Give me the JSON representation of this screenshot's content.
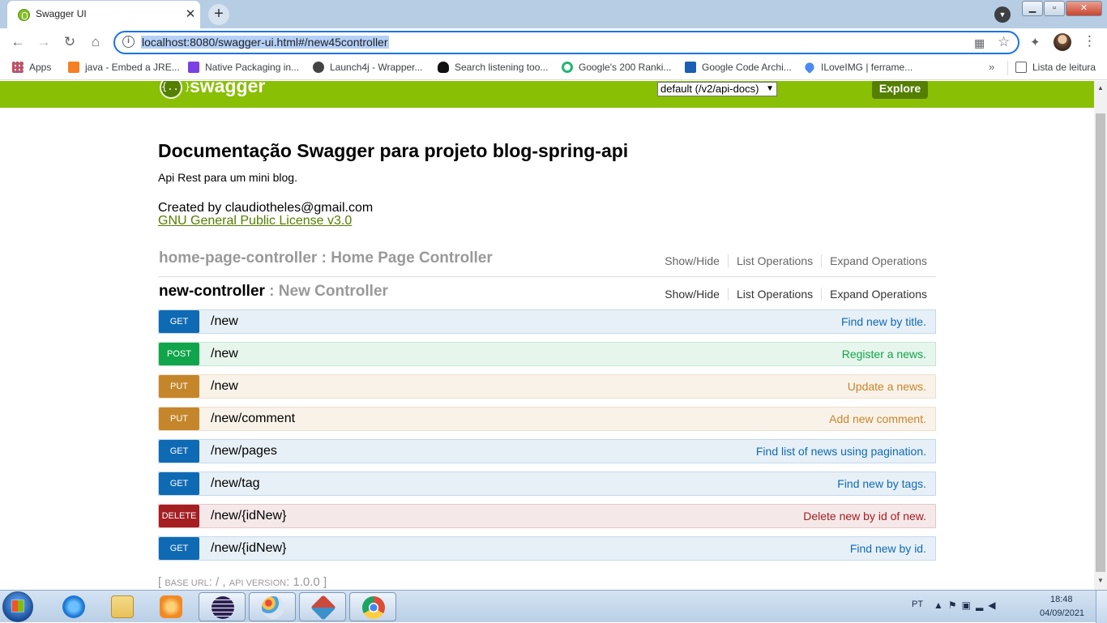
{
  "browser": {
    "tab_title": "Swagger UI",
    "tab_close": "✕",
    "new_tab": "+",
    "url": "localhost:8080/swagger-ui.html#/new45controller",
    "bookmarks": [
      {
        "label": "Apps",
        "color": "#e8453c"
      },
      {
        "label": "java - Embed a JRE...",
        "color": "#f48024"
      },
      {
        "label": "Native Packaging in...",
        "color": "#7b3fe4"
      },
      {
        "label": "Launch4j - Wrapper...",
        "color": "#444444"
      },
      {
        "label": "Search listening too...",
        "color": "#111111"
      },
      {
        "label": "Google's 200 Ranki...",
        "color": "#22b573"
      },
      {
        "label": "Google Code Archi...",
        "color": "#1a5fb4"
      },
      {
        "label": "ILoveIMG | ferrame...",
        "color": "#4a8af4"
      }
    ],
    "bookmarks_overflow": "»",
    "reading_list": "Lista de leitura"
  },
  "swagger": {
    "logo_icon": "{...}",
    "logo_text": "swagger",
    "spec_select": "default (/v2/api-docs)",
    "explore_label": "Explore",
    "info": {
      "title": "Documentação Swagger para projeto blog-spring-api",
      "description": "Api Rest para um mini blog.",
      "contact": "Created by claudiotheles@gmail.com",
      "license": "GNU General Public License v3.0"
    },
    "resources": [
      {
        "name": "home-page-controller",
        "description": " : Home Page Controller",
        "actions": [
          "Show/Hide",
          "List Operations",
          "Expand Operations"
        ]
      },
      {
        "name": "new-controller",
        "description": " : New Controller",
        "actions": [
          "Show/Hide",
          "List Operations",
          "Expand Operations"
        ],
        "operations": [
          {
            "method": "GET",
            "path": "/new",
            "summary": "Find new by title."
          },
          {
            "method": "POST",
            "path": "/new",
            "summary": "Register a news."
          },
          {
            "method": "PUT",
            "path": "/new",
            "summary": "Update a news."
          },
          {
            "method": "PUT",
            "path": "/new/comment",
            "summary": "Add new comment."
          },
          {
            "method": "GET",
            "path": "/new/pages",
            "summary": "Find list of news using pagination."
          },
          {
            "method": "GET",
            "path": "/new/tag",
            "summary": "Find new by tags."
          },
          {
            "method": "DELETE",
            "path": "/new/{idNew}",
            "summary": "Delete new by id of new."
          },
          {
            "method": "GET",
            "path": "/new/{idNew}",
            "summary": "Find new by id."
          }
        ]
      }
    ],
    "footer": {
      "open": "[ ",
      "base_url_label": "BASE URL",
      "base_url_value": ": / , ",
      "api_version_label": "API VERSION",
      "api_version_value": ": 1.0.0 ]"
    }
  },
  "taskbar": {
    "language": "PT",
    "time": "18:48",
    "date": "04/09/2021",
    "apps": [
      {
        "name": "internet-explorer",
        "color": "#1e78d2"
      },
      {
        "name": "file-explorer",
        "color": "#e8c15a"
      },
      {
        "name": "media-player",
        "color": "#f08a24"
      },
      {
        "name": "eclipse",
        "color": "#2c2255"
      },
      {
        "name": "paint",
        "color": "#9ab8d6"
      },
      {
        "name": "git-gui",
        "color": "#c94a3d"
      },
      {
        "name": "chrome",
        "color": "#dd4b39"
      }
    ]
  }
}
